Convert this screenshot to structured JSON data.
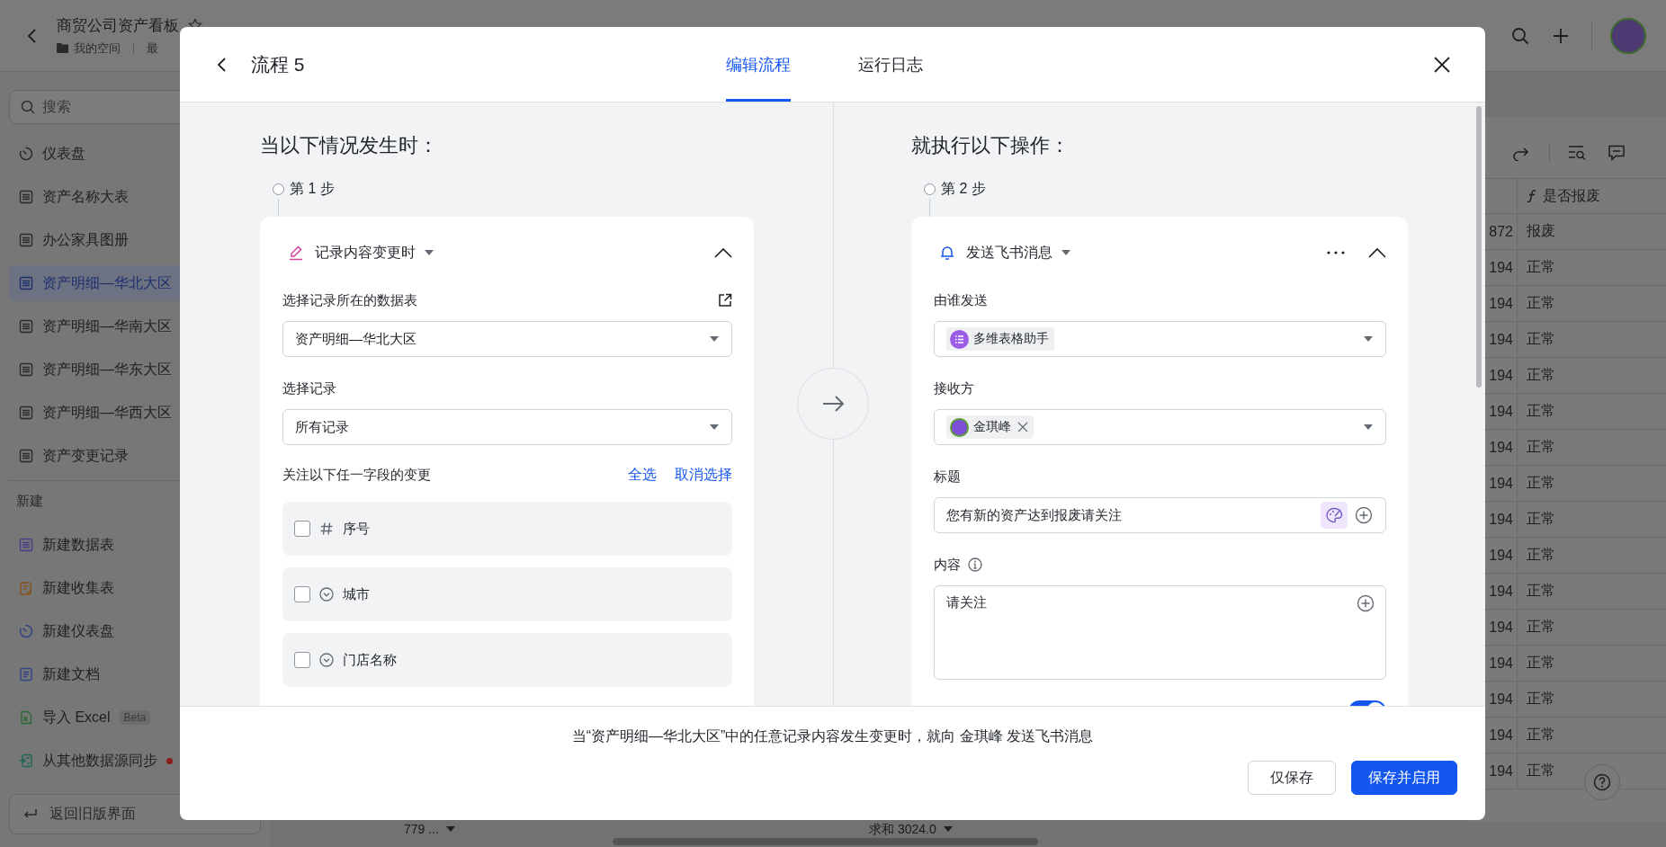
{
  "app_header": {
    "title": "商贸公司资产看板",
    "location": "我的空间",
    "recent": "最"
  },
  "sidebar": {
    "search": {
      "placeholder": "搜索"
    },
    "items": [
      {
        "label": "仪表盘",
        "kind": "dashboard",
        "selected": false
      },
      {
        "label": "资产名称大表",
        "kind": "table",
        "selected": false
      },
      {
        "label": "办公家具图册",
        "kind": "table",
        "selected": false
      },
      {
        "label": "资产明细—华北大区",
        "kind": "table",
        "selected": true
      },
      {
        "label": "资产明细—华南大区",
        "kind": "table",
        "selected": false
      },
      {
        "label": "资产明细—华东大区",
        "kind": "table",
        "selected": false
      },
      {
        "label": "资产明细—华西大区",
        "kind": "table",
        "selected": false
      },
      {
        "label": "资产变更记录",
        "kind": "table",
        "selected": false
      }
    ],
    "create_heading": "新建",
    "create_items": [
      {
        "label": "新建数据表",
        "kind": "table"
      },
      {
        "label": "新建收集表",
        "kind": "form"
      },
      {
        "label": "新建仪表盘",
        "kind": "dashboard"
      },
      {
        "label": "新建文档",
        "kind": "doc"
      },
      {
        "label": "导入 Excel",
        "kind": "excel",
        "badge": "Beta"
      },
      {
        "label": "从其他数据源同步",
        "kind": "sync",
        "unread_dot": true
      }
    ],
    "back_button": "返回旧版界面"
  },
  "table": {
    "columns": [
      {
        "label": "是否报废",
        "kind": "formula"
      }
    ],
    "rows": [
      {
        "cells": [
          "872",
          "报废"
        ]
      },
      {
        "cells": [
          "194",
          "正常"
        ]
      },
      {
        "cells": [
          "194",
          "正常"
        ]
      },
      {
        "cells": [
          "194",
          "正常"
        ]
      },
      {
        "cells": [
          "194",
          "正常"
        ]
      },
      {
        "cells": [
          "194",
          "正常"
        ]
      },
      {
        "cells": [
          "194",
          "正常"
        ]
      },
      {
        "cells": [
          "194",
          "正常"
        ]
      },
      {
        "cells": [
          "194",
          "正常"
        ]
      },
      {
        "cells": [
          "194",
          "正常"
        ]
      },
      {
        "cells": [
          "194",
          "正常"
        ]
      },
      {
        "cells": [
          "194",
          "正常"
        ]
      },
      {
        "cells": [
          "194",
          "正常"
        ]
      },
      {
        "cells": [
          "194",
          "正常"
        ]
      },
      {
        "cells": [
          "194",
          "正常"
        ]
      },
      {
        "cells": [
          "194",
          "正常"
        ]
      }
    ],
    "footer": {
      "column_summary": "779 ...",
      "sum": "求和 3024.0"
    }
  },
  "dialog": {
    "title": "流程 5",
    "tabs": [
      {
        "label": "编辑流程",
        "selected": true
      },
      {
        "label": "运行日志",
        "selected": false
      }
    ],
    "trigger": {
      "heading": "当以下情况发生时：",
      "step": "第 1 步",
      "title": "记录内容变更时",
      "table_label": "选择记录所在的数据表",
      "table_value": "资产明细—华北大区",
      "records_label": "选择记录",
      "records_value": "所有记录",
      "watch_label": "关注以下任一字段的变更",
      "select_all": "全选",
      "clear_selection": "取消选择",
      "fields": [
        {
          "label": "序号",
          "kind": "number",
          "checked": false
        },
        {
          "label": "城市",
          "kind": "option",
          "checked": false
        },
        {
          "label": "门店名称",
          "kind": "option",
          "checked": false
        }
      ]
    },
    "action": {
      "heading": "就执行以下操作：",
      "step": "第 2 步",
      "title": "发送飞书消息",
      "sender_label": "由谁发送",
      "sender": "多维表格助手",
      "recipient_label": "接收方",
      "recipients": [
        {
          "name": "金琪峰"
        }
      ],
      "subject_label": "标题",
      "subject_value": "您有新的资产达到报废请关注",
      "content_label": "内容",
      "content_value": "请关注",
      "notify_toggle": {
        "on": true
      }
    },
    "summary": "当“资产明细—华北大区”中的任意记录内容发生变更时，就向 金琪峰 发送飞书消息",
    "buttons": [
      {
        "label": "仅保存",
        "kind": "secondary"
      },
      {
        "label": "保存并启用",
        "kind": "primary"
      }
    ]
  }
}
